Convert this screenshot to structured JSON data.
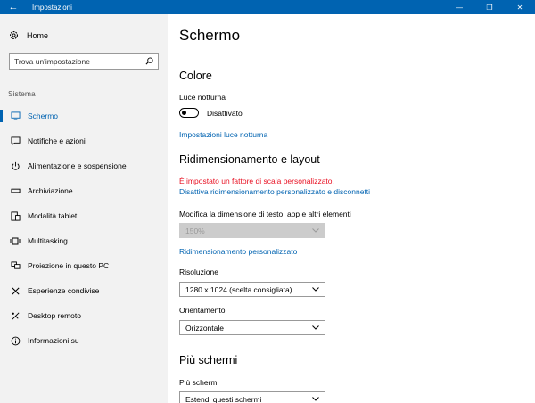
{
  "window": {
    "title": "Impostazioni",
    "back_glyph": "←",
    "minimize_glyph": "—",
    "maximize_glyph": "❐",
    "close_glyph": "✕",
    "accent_color": "#0063b1"
  },
  "sidebar": {
    "home_label": "Home",
    "home_icon": "gear-icon",
    "search_placeholder": "Trova un'impostazione",
    "search_icon": "search-icon",
    "section_label": "Sistema",
    "items": [
      {
        "label": "Schermo",
        "icon": "monitor-icon",
        "active": true
      },
      {
        "label": "Notifiche e azioni",
        "icon": "notification-icon"
      },
      {
        "label": "Alimentazione e sospensione",
        "icon": "power-icon"
      },
      {
        "label": "Archiviazione",
        "icon": "storage-icon"
      },
      {
        "label": "Modalità tablet",
        "icon": "tablet-icon"
      },
      {
        "label": "Multitasking",
        "icon": "multitasking-icon"
      },
      {
        "label": "Proiezione in questo PC",
        "icon": "projection-icon"
      },
      {
        "label": "Esperienze condivise",
        "icon": "shared-icon"
      },
      {
        "label": "Desktop remoto",
        "icon": "remote-desktop-icon"
      },
      {
        "label": "Informazioni su",
        "icon": "info-icon"
      }
    ]
  },
  "main": {
    "title": "Schermo",
    "color_section": {
      "heading": "Colore",
      "night_light_label": "Luce notturna",
      "toggle_state": "Disattivato",
      "toggle_on": false,
      "settings_link": "Impostazioni luce notturna"
    },
    "scale_section": {
      "heading": "Ridimensionamento e layout",
      "warning": "È impostato un fattore di scala personalizzato.",
      "disable_link": "Disattiva ridimensionamento personalizzato e disconnetti",
      "size_label": "Modifica la dimensione di testo, app e altri elementi",
      "size_value": "150%",
      "custom_link": "Ridimensionamento personalizzato",
      "resolution_label": "Risoluzione",
      "resolution_value": "1280 x 1024 (scelta consigliata)",
      "orientation_label": "Orientamento",
      "orientation_value": "Orizzontale"
    },
    "multi_section": {
      "heading": "Più schermi",
      "label": "Più schermi",
      "value": "Estendi questi schermi"
    }
  }
}
